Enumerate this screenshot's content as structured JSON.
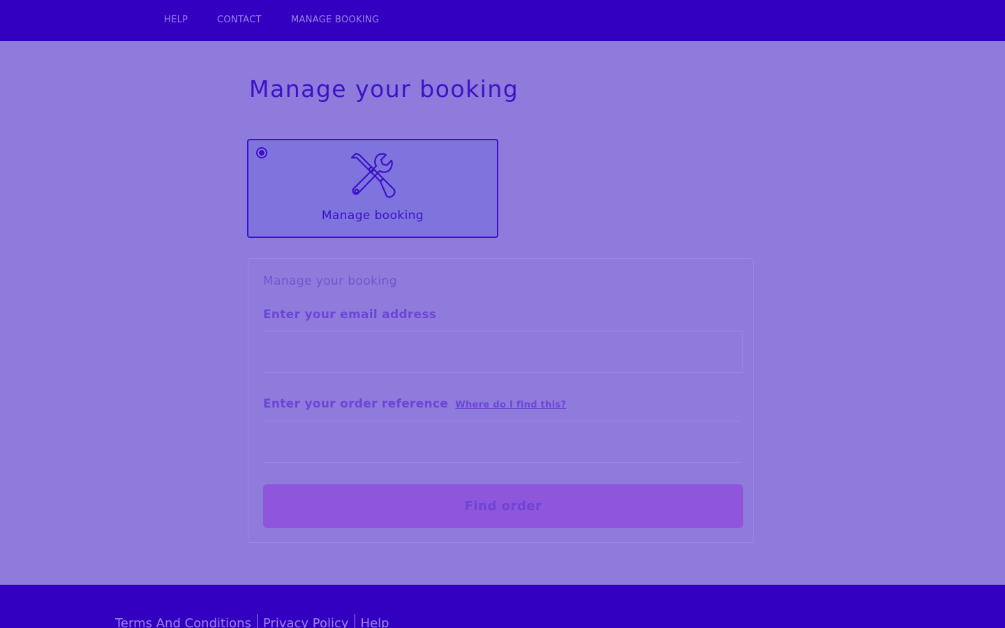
{
  "nav": {
    "help": "HELP",
    "contact": "CONTACT",
    "manage_booking": "MANAGE BOOKING"
  },
  "page": {
    "title": "Manage your booking"
  },
  "option_card": {
    "label": "Manage booking",
    "icon": "tools-icon",
    "selected": true
  },
  "form": {
    "legend": "Manage your booking",
    "email_label": "Enter your email address",
    "email_value": "",
    "ref_label": "Enter your order reference",
    "ref_help_link": "Where do I find this?",
    "ref_value": "",
    "submit_label": "Find order"
  },
  "footer": {
    "links": [
      "Terms And Conditions",
      "Privacy Policy",
      "Help"
    ]
  },
  "colors": {
    "header_bg": "#3300c2",
    "page_bg": "#8f7bdc",
    "accent": "#3a12c8",
    "button_bg": "#8e56da"
  }
}
